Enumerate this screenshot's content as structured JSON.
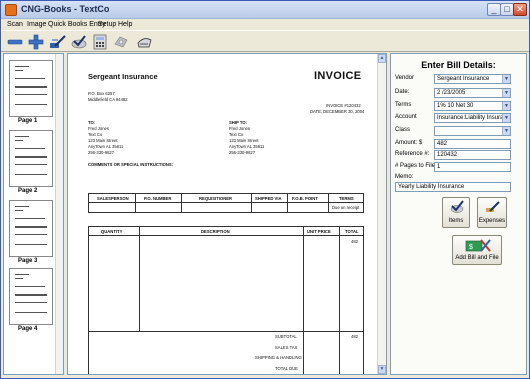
{
  "window": {
    "title": "CNG-Books - TextCo"
  },
  "menu": [
    "Scan",
    "Image",
    "Quick Books Entry",
    "Setup",
    "Help"
  ],
  "toolbar": {
    "icons": [
      "minus-icon",
      "plus-icon",
      "pen-icon",
      "checkmark-icon",
      "calculator-icon",
      "gear-icon",
      "print-icon"
    ]
  },
  "thumbnails": [
    "Page 1",
    "Page 2",
    "Page 3",
    "Page 4"
  ],
  "invoice": {
    "company": "Sergeant Insurance",
    "address1": "P.O. Box 6257",
    "address2": "Middlefield CA 94482",
    "title": "INVOICE",
    "invoice_no": "INVOICE #120432",
    "date": "DATE: DECEMBER 30, 2004",
    "to_label": "TO:",
    "to_lines": [
      "Fred Jones",
      "Text Co",
      "123 Main Street",
      "AnyTown AL 35611",
      "256-330-9627"
    ],
    "shipto_label": "SHIP TO:",
    "shipto_lines": [
      "Fred Jones",
      "Text Co",
      "123 Main Street",
      "AnyTown AL 35611",
      "256-330-9627"
    ],
    "comments": "COMMENTS OR SPECIAL INSTRUCTIONS:",
    "info_headers": [
      "SALESPERSON",
      "P.O. NUMBER",
      "REQUISITIONER",
      "SHIPPED VIA",
      "F.O.B. POINT",
      "TERMS"
    ],
    "info_values": [
      "",
      "",
      "",
      "",
      "",
      "Due on receipt"
    ],
    "item_headers": [
      "QUANTITY",
      "DESCRIPTION",
      "UNIT PRICE",
      "TOTAL"
    ],
    "item_total": "482",
    "subtotal_label": "SUBTOTAL",
    "subtotal_value": "482",
    "salestax_label": "SALES TAX",
    "shipping_label": "SHIPPING & HANDLING",
    "totaldue_label": "TOTAL DUE"
  },
  "bill": {
    "title": "Enter Bill Details:",
    "vendor_label": "Vendor",
    "vendor": "Sergeant Insurance",
    "date_label": "Date:",
    "date": "2 /23/2005",
    "terms_label": "Terms",
    "terms": "1% 10 Net 30",
    "account_label": "Account",
    "account": "Insurance:Liability Insuran",
    "class_label": "Class",
    "class": "",
    "amount_label": "Amount: $",
    "amount": "482",
    "reference_label": "Reference #:",
    "reference": "120432",
    "pages_label": "# Pages to File:",
    "pages": "1",
    "memo_label": "Memo:",
    "memo": "Yearly Liability Insurance",
    "items_button": "Items",
    "expenses_button": "Expenses",
    "addfile_button": "Add Bill and File"
  }
}
